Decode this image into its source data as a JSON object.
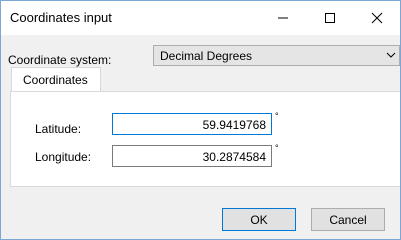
{
  "window": {
    "title": "Coordinates input",
    "controls": {
      "minimize_icon": "minimize-icon",
      "maximize_icon": "maximize-icon",
      "close_icon": "close-icon"
    }
  },
  "coordinate_system": {
    "label": "Coordinate system:",
    "selected": "Decimal Degrees",
    "dropdown_icon": "chevron-down-icon"
  },
  "tabs": [
    {
      "label": "Coordinates",
      "active": true
    }
  ],
  "fields": {
    "latitude": {
      "label": "Latitude:",
      "value": "59.9419768",
      "unit": "°"
    },
    "longitude": {
      "label": "Longitude:",
      "value": "30.2874584",
      "unit": "°"
    }
  },
  "buttons": {
    "ok": "OK",
    "cancel": "Cancel"
  },
  "colors": {
    "focus_border": "#0078d7",
    "window_border": "#7aa7d6",
    "dialog_bg": "#f0f0f0"
  }
}
